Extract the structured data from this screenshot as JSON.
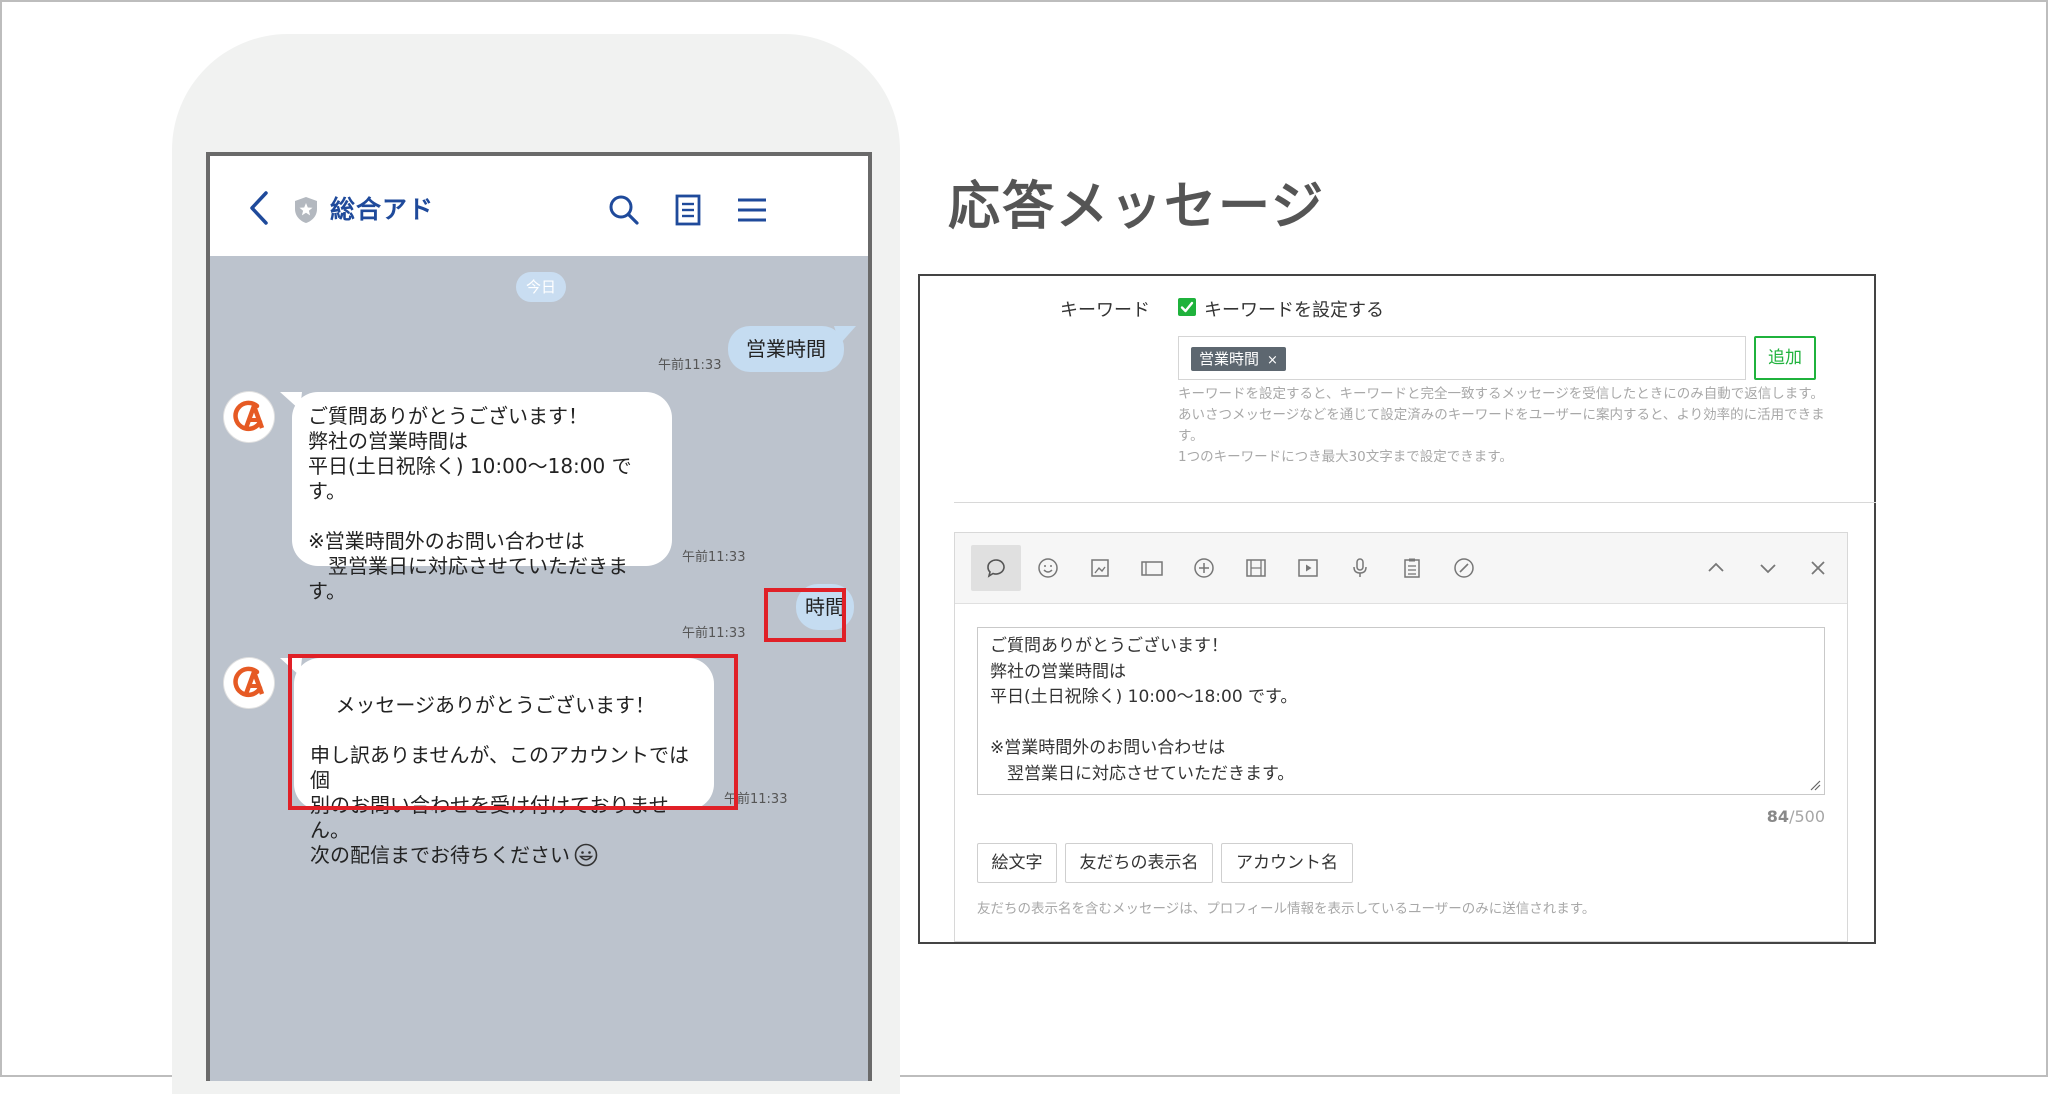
{
  "chat": {
    "title": "総合アド",
    "date_label": "今日",
    "messages": [
      {
        "sender": "user",
        "text": "営業時間",
        "time": "午前11:33"
      },
      {
        "sender": "account",
        "text": "ご質問ありがとうございます！\n弊社の営業時間は\n平日(土日祝除く) 10:00〜18:00 です。\n\n※営業時間外のお問い合わせは\n　翌営業日に対応させていただきます。",
        "time": "午前11:33"
      },
      {
        "sender": "user",
        "text": "時間",
        "time": "午前11:33"
      },
      {
        "sender": "account",
        "text": "メッセージありがとうございます！\n\n申し訳ありませんが、このアカウントでは個\n別のお問い合わせを受け付けておりません。\n次の配信までお待ちください",
        "time": "午前11:33"
      }
    ]
  },
  "panel": {
    "section_title": "応答メッセージ",
    "keyword_label": "キーワード",
    "keyword_checkbox_label": "キーワードを設定する",
    "keyword_checked": true,
    "keyword_tags": [
      "営業時間"
    ],
    "tag_remove": "×",
    "add_button": "追加",
    "keyword_help": "キーワードを設定すると、キーワードと完全一致するメッセージを受信したときにのみ自動で返信します。あいさつメッセージなどを通じて設定済みのキーワードをユーザーに案内すると、より効率的に活用できます。\n1つのキーワードにつき最大30文字まで設定できます。",
    "toolbar_icons": [
      "speech-bubble-icon",
      "smiley-icon",
      "image-icon",
      "card-icon",
      "coupon-icon",
      "video-frames-icon",
      "play-icon",
      "microphone-icon",
      "clipboard-icon",
      "pen-icon"
    ],
    "toolbar_right_icons": [
      "chevron-up-icon",
      "chevron-down-icon",
      "close-icon"
    ],
    "message_text": "ご質問ありがとうございます！\n弊社の営業時間は\n平日(土日祝除く) 10:00〜18:00 です。\n\n※営業時間外のお問い合わせは\n　翌営業日に対応させていただきます。",
    "char_count_current": "84",
    "char_count_max": "/500",
    "insert_buttons": [
      "絵文字",
      "友だちの表示名",
      "アカウント名"
    ],
    "editor_note": "友だちの表示名を含むメッセージは、プロフィール情報を表示しているユーザーのみに送信されます。"
  },
  "colors": {
    "accent_green": "#1fb23c",
    "highlight_red": "#e02027",
    "chat_background": "#bcc3cd",
    "user_bubble": "#c5dcf1",
    "title_blue": "#1f4a9b"
  }
}
